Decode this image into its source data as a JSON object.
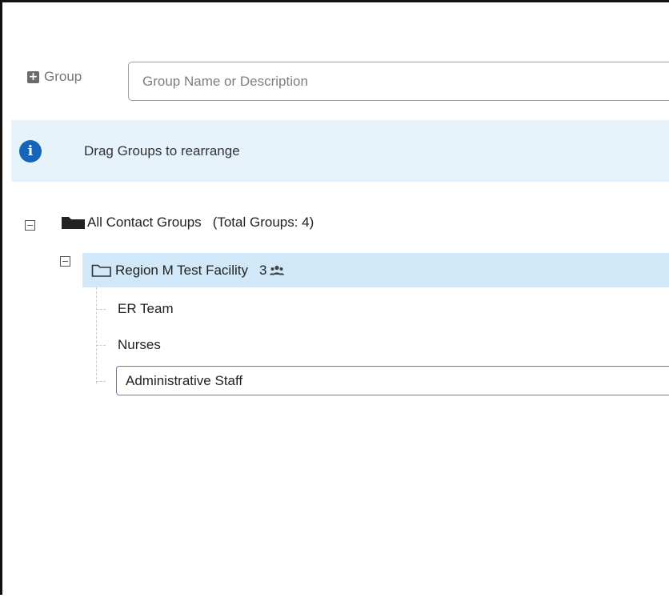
{
  "toolbar": {
    "add_group_label": "Group",
    "search_placeholder": "Group Name or Description",
    "search_value": ""
  },
  "info_banner": {
    "text": "Drag Groups to rearrange",
    "icon": "info-icon",
    "color": "#1565b8",
    "background": "#e6f3fb"
  },
  "tree": {
    "root": {
      "label": "All Contact Groups",
      "total_label": "(Total Groups: 4)"
    },
    "group": {
      "label": "Region M Test Facility",
      "count": "3",
      "selected_background": "#d0e8f7"
    },
    "children": [
      {
        "label": "ER Team"
      },
      {
        "label": "Nurses"
      }
    ],
    "editing_child_value": "Administrative Staff"
  }
}
